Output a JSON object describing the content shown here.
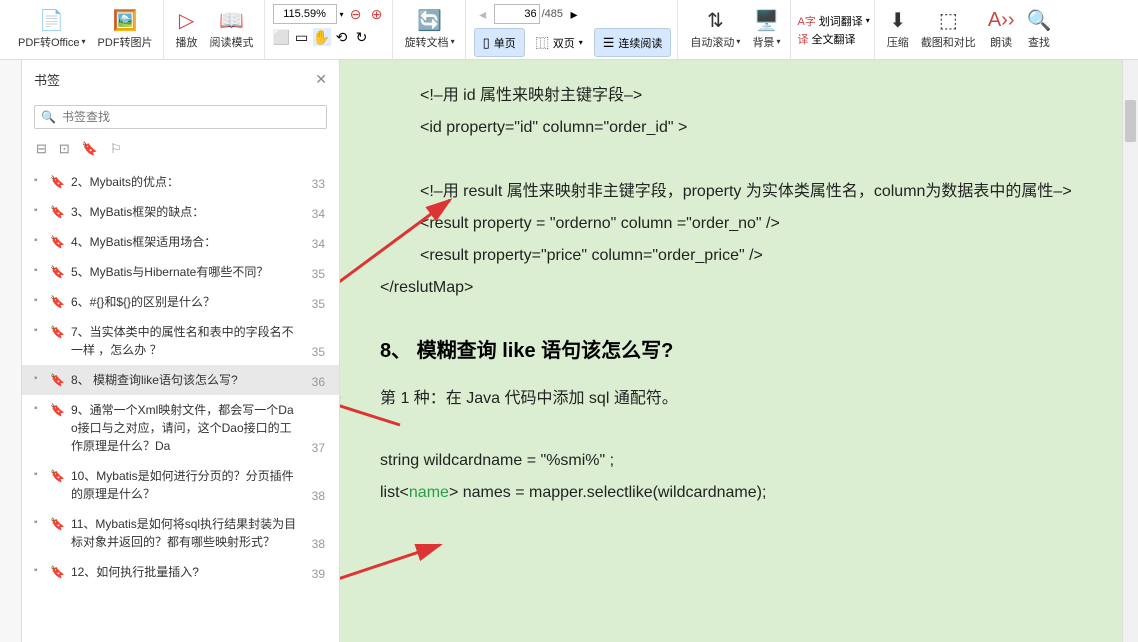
{
  "toolbar": {
    "pdf2office": "PDF转Office",
    "pdf2pic": "PDF转图片",
    "play": "播放",
    "readmode": "阅读模式",
    "zoom_value": "115.59%",
    "rotate": "旋转文档",
    "page_current": "36",
    "page_total": "/485",
    "single_page": "单页",
    "double_page": "双页",
    "continuous": "连续阅读",
    "autoscroll": "自动滚动",
    "background": "背景",
    "word_trans": "划词翻译",
    "full_trans": "全文翻译",
    "compress": "压缩",
    "crop_compare": "截图和对比",
    "readaloud": "朗读",
    "find": "查找"
  },
  "sidebar": {
    "title": "书签",
    "search_placeholder": "书签查找",
    "items": [
      {
        "text": "2、Mybaits的优点：",
        "page": "33",
        "has_children": true
      },
      {
        "text": "3、MyBatis框架的缺点：",
        "page": "34",
        "has_children": true
      },
      {
        "text": "4、MyBatis框架适用场合：",
        "page": "34",
        "has_children": true
      },
      {
        "text": "5、MyBatis与Hibernate有哪些不同？",
        "page": "35",
        "has_children": true
      },
      {
        "text": "6、#{}和${}的区别是什么？",
        "page": "35",
        "has_children": true
      },
      {
        "text": "7、当实体类中的属性名和表中的字段名不一样 ，怎么办 ？",
        "page": "35",
        "has_children": true
      },
      {
        "text": "8、 模糊查询like语句该怎么写?",
        "page": "36",
        "has_children": true,
        "active": true
      },
      {
        "text": "9、通常一个Xml映射文件，都会写一个Dao接口与之对应，请问，这个Dao接口的工作原理是什么？Da",
        "page": "37",
        "has_children": true
      },
      {
        "text": "10、Mybatis是如何进行分页的？分页插件的原理是什么？",
        "page": "38",
        "has_children": true
      },
      {
        "text": "11、Mybatis是如何将sql执行结果封装为目标对象并返回的？都有哪些映射形式？",
        "page": "38",
        "has_children": true
      },
      {
        "text": "12、如何执行批量插入?",
        "page": "39",
        "has_children": true
      }
    ]
  },
  "document": {
    "lines": [
      "<!–用 id 属性来映射主键字段–>",
      "<id property=\"id\" column=\"order_id\" >",
      "",
      "<!–用 result 属性来映射非主键字段，property 为实体类属性名，column为数据表中的属性–>",
      "<result property = \"orderno\" column =\"order_no\" />",
      "<result property=\"price\" column=\"order_price\" />",
      "</reslutMap>"
    ],
    "heading": "8、 模糊查询 like 语句该怎么写?",
    "para1": "第 1 种：在 Java 代码中添加 sql 通配符。",
    "code1": "string wildcardname = \"%smi%\" ;",
    "code2_pre": "list<",
    "code2_name": "name",
    "code2_post": "> names = mapper.selectlike(wildcardname);"
  }
}
